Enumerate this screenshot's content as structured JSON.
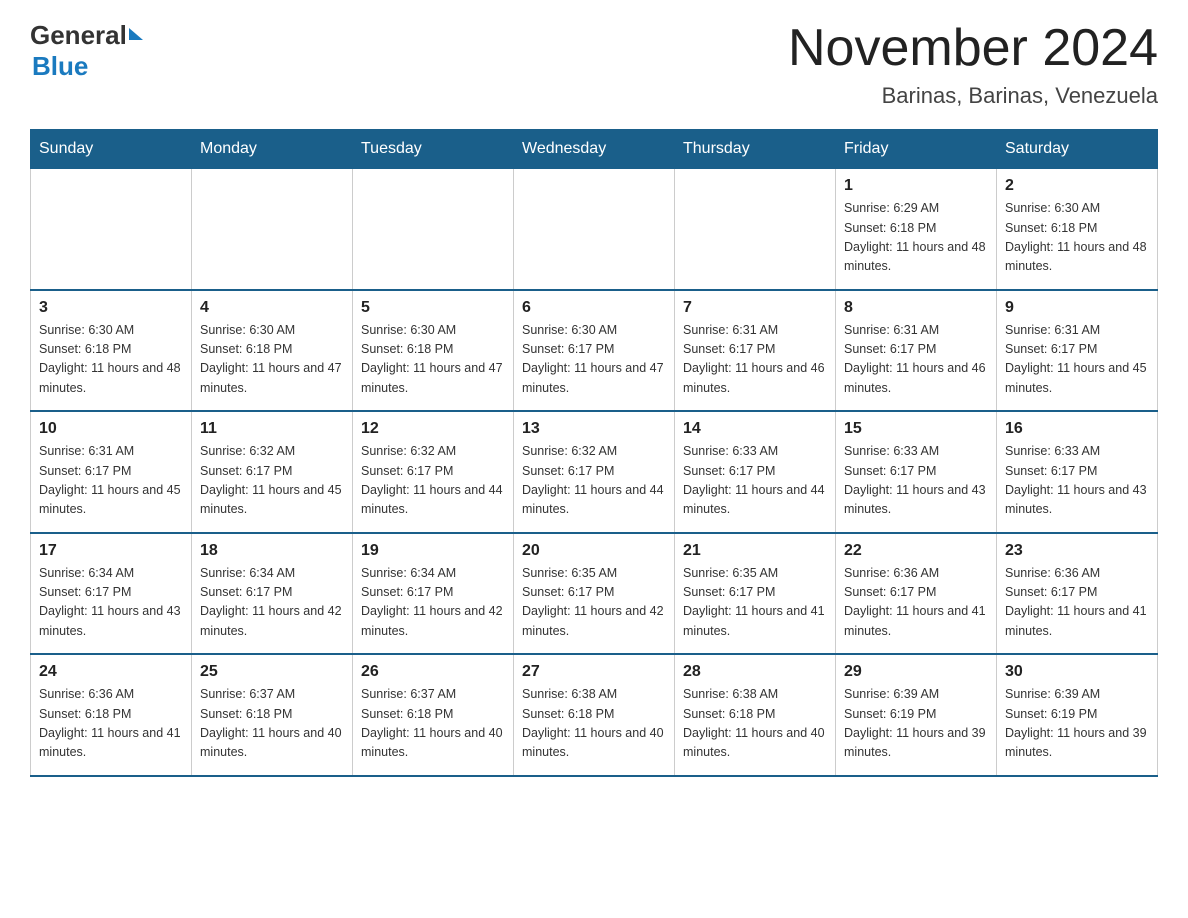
{
  "header": {
    "logo": {
      "general": "General",
      "arrow": "▶",
      "blue": "Blue"
    },
    "title": "November 2024",
    "subtitle": "Barinas, Barinas, Venezuela"
  },
  "days_of_week": [
    "Sunday",
    "Monday",
    "Tuesday",
    "Wednesday",
    "Thursday",
    "Friday",
    "Saturday"
  ],
  "weeks": [
    [
      {
        "day": "",
        "info": "",
        "empty": true
      },
      {
        "day": "",
        "info": "",
        "empty": true
      },
      {
        "day": "",
        "info": "",
        "empty": true
      },
      {
        "day": "",
        "info": "",
        "empty": true
      },
      {
        "day": "",
        "info": "",
        "empty": true
      },
      {
        "day": "1",
        "info": "Sunrise: 6:29 AM\nSunset: 6:18 PM\nDaylight: 11 hours and 48 minutes.",
        "empty": false
      },
      {
        "day": "2",
        "info": "Sunrise: 6:30 AM\nSunset: 6:18 PM\nDaylight: 11 hours and 48 minutes.",
        "empty": false
      }
    ],
    [
      {
        "day": "3",
        "info": "Sunrise: 6:30 AM\nSunset: 6:18 PM\nDaylight: 11 hours and 48 minutes.",
        "empty": false
      },
      {
        "day": "4",
        "info": "Sunrise: 6:30 AM\nSunset: 6:18 PM\nDaylight: 11 hours and 47 minutes.",
        "empty": false
      },
      {
        "day": "5",
        "info": "Sunrise: 6:30 AM\nSunset: 6:18 PM\nDaylight: 11 hours and 47 minutes.",
        "empty": false
      },
      {
        "day": "6",
        "info": "Sunrise: 6:30 AM\nSunset: 6:17 PM\nDaylight: 11 hours and 47 minutes.",
        "empty": false
      },
      {
        "day": "7",
        "info": "Sunrise: 6:31 AM\nSunset: 6:17 PM\nDaylight: 11 hours and 46 minutes.",
        "empty": false
      },
      {
        "day": "8",
        "info": "Sunrise: 6:31 AM\nSunset: 6:17 PM\nDaylight: 11 hours and 46 minutes.",
        "empty": false
      },
      {
        "day": "9",
        "info": "Sunrise: 6:31 AM\nSunset: 6:17 PM\nDaylight: 11 hours and 45 minutes.",
        "empty": false
      }
    ],
    [
      {
        "day": "10",
        "info": "Sunrise: 6:31 AM\nSunset: 6:17 PM\nDaylight: 11 hours and 45 minutes.",
        "empty": false
      },
      {
        "day": "11",
        "info": "Sunrise: 6:32 AM\nSunset: 6:17 PM\nDaylight: 11 hours and 45 minutes.",
        "empty": false
      },
      {
        "day": "12",
        "info": "Sunrise: 6:32 AM\nSunset: 6:17 PM\nDaylight: 11 hours and 44 minutes.",
        "empty": false
      },
      {
        "day": "13",
        "info": "Sunrise: 6:32 AM\nSunset: 6:17 PM\nDaylight: 11 hours and 44 minutes.",
        "empty": false
      },
      {
        "day": "14",
        "info": "Sunrise: 6:33 AM\nSunset: 6:17 PM\nDaylight: 11 hours and 44 minutes.",
        "empty": false
      },
      {
        "day": "15",
        "info": "Sunrise: 6:33 AM\nSunset: 6:17 PM\nDaylight: 11 hours and 43 minutes.",
        "empty": false
      },
      {
        "day": "16",
        "info": "Sunrise: 6:33 AM\nSunset: 6:17 PM\nDaylight: 11 hours and 43 minutes.",
        "empty": false
      }
    ],
    [
      {
        "day": "17",
        "info": "Sunrise: 6:34 AM\nSunset: 6:17 PM\nDaylight: 11 hours and 43 minutes.",
        "empty": false
      },
      {
        "day": "18",
        "info": "Sunrise: 6:34 AM\nSunset: 6:17 PM\nDaylight: 11 hours and 42 minutes.",
        "empty": false
      },
      {
        "day": "19",
        "info": "Sunrise: 6:34 AM\nSunset: 6:17 PM\nDaylight: 11 hours and 42 minutes.",
        "empty": false
      },
      {
        "day": "20",
        "info": "Sunrise: 6:35 AM\nSunset: 6:17 PM\nDaylight: 11 hours and 42 minutes.",
        "empty": false
      },
      {
        "day": "21",
        "info": "Sunrise: 6:35 AM\nSunset: 6:17 PM\nDaylight: 11 hours and 41 minutes.",
        "empty": false
      },
      {
        "day": "22",
        "info": "Sunrise: 6:36 AM\nSunset: 6:17 PM\nDaylight: 11 hours and 41 minutes.",
        "empty": false
      },
      {
        "day": "23",
        "info": "Sunrise: 6:36 AM\nSunset: 6:17 PM\nDaylight: 11 hours and 41 minutes.",
        "empty": false
      }
    ],
    [
      {
        "day": "24",
        "info": "Sunrise: 6:36 AM\nSunset: 6:18 PM\nDaylight: 11 hours and 41 minutes.",
        "empty": false
      },
      {
        "day": "25",
        "info": "Sunrise: 6:37 AM\nSunset: 6:18 PM\nDaylight: 11 hours and 40 minutes.",
        "empty": false
      },
      {
        "day": "26",
        "info": "Sunrise: 6:37 AM\nSunset: 6:18 PM\nDaylight: 11 hours and 40 minutes.",
        "empty": false
      },
      {
        "day": "27",
        "info": "Sunrise: 6:38 AM\nSunset: 6:18 PM\nDaylight: 11 hours and 40 minutes.",
        "empty": false
      },
      {
        "day": "28",
        "info": "Sunrise: 6:38 AM\nSunset: 6:18 PM\nDaylight: 11 hours and 40 minutes.",
        "empty": false
      },
      {
        "day": "29",
        "info": "Sunrise: 6:39 AM\nSunset: 6:19 PM\nDaylight: 11 hours and 39 minutes.",
        "empty": false
      },
      {
        "day": "30",
        "info": "Sunrise: 6:39 AM\nSunset: 6:19 PM\nDaylight: 11 hours and 39 minutes.",
        "empty": false
      }
    ]
  ]
}
